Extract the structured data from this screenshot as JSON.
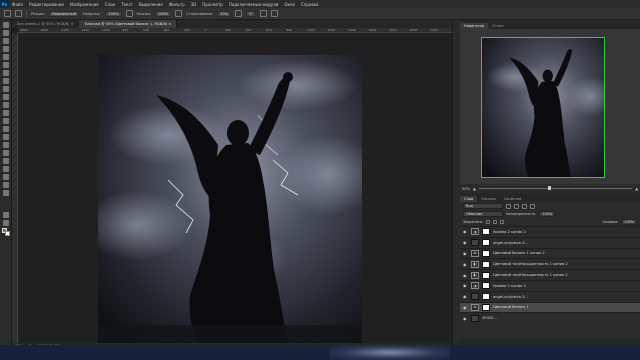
{
  "app": {
    "logo": "Ps"
  },
  "menu": [
    "Файл",
    "Редактирование",
    "Изображение",
    "Слои",
    "Текст",
    "Выделение",
    "Фильтр",
    "3D",
    "Просмотр",
    "Подключаемые модули",
    "Окно",
    "Справка"
  ],
  "options": {
    "mode_label": "Режим:",
    "mode_value": "Нормальный",
    "opacity_label": "Непрозр.:",
    "opacity_value": "100%",
    "flow_label": "Нажим:",
    "flow_value": "100%",
    "smooth_label": "Сглаживание:",
    "smooth_value": "10%",
    "angle_value": "0°"
  },
  "tabs": [
    {
      "label": "Без имени-1 @ 50% (RGB/8) ×",
      "active": false
    },
    {
      "label": "Tutorpsd @ 50% (Цветовой баланс 1, RGB/8) ×",
      "active": true
    }
  ],
  "ruler_ticks": [
    "1800",
    "1600",
    "1400",
    "1200",
    "1000",
    "800",
    "600",
    "400",
    "200",
    "0",
    "200",
    "400",
    "600",
    "800",
    "1000",
    "1200",
    "1400",
    "1600",
    "1800",
    "2000",
    "2200"
  ],
  "status": {
    "zoom": "50%",
    "doc_size": "Док: 7,03M/42,5M"
  },
  "panel": {
    "tabs": [
      "Навигатор",
      "Стили"
    ],
    "zoom": "50%",
    "zoom_level": 0.45,
    "layer_tabs": [
      "Слои",
      "Каналы",
      "Свойства"
    ],
    "filter_label": "Вид",
    "blend_mode": "Обычные",
    "opacity_label": "Непрозрачность:",
    "opacity_value": "100%",
    "lock_label": "Закрепить:",
    "fill_label": "Заливка:",
    "fill_value": "100%"
  },
  "layers": [
    {
      "name": "Уровни 2 копия 2",
      "thumb": "adj",
      "mask": "white",
      "selected": false
    },
    {
      "name": "angel-sculpture-3...",
      "thumb": "dark",
      "mask": "white",
      "selected": false
    },
    {
      "name": "Цветовой баланс 1 копия 2",
      "thumb": "adj",
      "mask": "white",
      "selected": false
    },
    {
      "name": "Цветовой тон/Насыщенность 1 копия 2",
      "thumb": "adj",
      "mask": "white",
      "selected": false
    },
    {
      "name": "Цветовой тон/Насыщенность 1 копия 2",
      "thumb": "adj",
      "mask": "white",
      "selected": false
    },
    {
      "name": "Уровни 2 копия 3",
      "thumb": "adj",
      "mask": "white",
      "selected": false
    },
    {
      "name": "angel-sculpture-3...",
      "thumb": "dark",
      "mask": "white",
      "selected": false
    },
    {
      "name": "Цветовой баланс 1",
      "thumb": "adj",
      "mask": "white",
      "selected": true
    },
    {
      "name": "39420...",
      "thumb": "dark",
      "mask": "none",
      "selected": false
    }
  ]
}
